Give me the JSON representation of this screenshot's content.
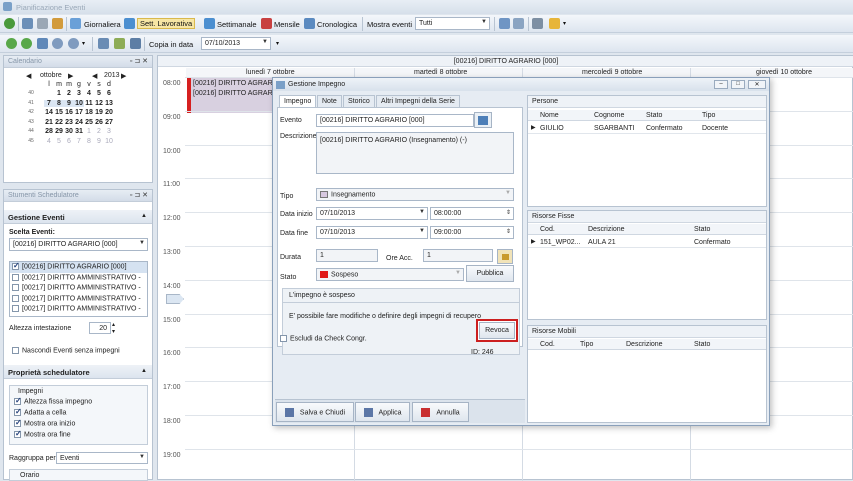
{
  "app": {
    "title": "Pianificazione Eventi"
  },
  "toolbar1": {
    "giornaliera": "Giornaliera",
    "sett_lavorativa": "Sett. Lavorativa",
    "settimanale": "Settimanale",
    "mensile": "Mensile",
    "cronologica": "Cronologica",
    "mostra_eventi_label": "Mostra eventi",
    "mostra_eventi_value": "Tutti"
  },
  "toolbar2": {
    "copia_label": "Copia in data",
    "copia_value": "07/10/2013"
  },
  "calendar": {
    "title": "Calendario",
    "month": "ottobre",
    "year": "2013",
    "weekdays": [
      "l",
      "m",
      "m",
      "g",
      "v",
      "s",
      "d"
    ],
    "weeks": [
      [
        "40",
        "",
        "1",
        "2",
        "3",
        "4",
        "5",
        "6"
      ],
      [
        "41",
        "7",
        "8",
        "9",
        "10",
        "11",
        "12",
        "13"
      ],
      [
        "42",
        "14",
        "15",
        "16",
        "17",
        "18",
        "19",
        "20"
      ],
      [
        "43",
        "21",
        "22",
        "23",
        "24",
        "25",
        "26",
        "27"
      ],
      [
        "44",
        "28",
        "29",
        "30",
        "31",
        "1",
        "2",
        "3"
      ],
      [
        "45",
        "4",
        "5",
        "6",
        "7",
        "8",
        "9",
        "10"
      ]
    ]
  },
  "strumenti": {
    "title": "Stumenti Schedulatore",
    "gestione": "Gestione Eventi",
    "scelta_label": "Scelta Eventi:",
    "scelta_value": "[00216] DIRITTO AGRARIO [000]",
    "events": [
      "[00216] DIRITTO AGRARIO [000]",
      "[00217] DIRITTO AMMINISTRATIVO -",
      "[00217] DIRITTO AMMINISTRATIVO -",
      "[00217] DIRITTO AMMINISTRATIVO -",
      "[00217] DIRITTO AMMINISTRATIVO -"
    ],
    "altezza_label": "Altezza intestazione",
    "altezza_value": "20",
    "nascondi": "Nascondi Eventi senza impegni"
  },
  "proprieta": {
    "title": "Proprietà schedulatore",
    "impegni": "Impegni",
    "opts": [
      "Altezza fissa impegno",
      "Adatta a cella",
      "Mostra ora inizio",
      "Mostra ora fine"
    ],
    "raggruppa_label": "Raggruppa per",
    "raggruppa_value": "Eventi",
    "orario": "Orario"
  },
  "scheduler": {
    "resource": "[00216] DIRITTO AGRARIO [000]",
    "days": [
      "lunedì 7 ottobre",
      "martedì 8 ottobre",
      "mercoledì 9 ottobre",
      "giovedì 10 ottobre"
    ],
    "times": [
      "08:00",
      "09:00",
      "10:00",
      "11:00",
      "12:00",
      "13:00",
      "14:00",
      "15:00",
      "16:00",
      "17:00",
      "18:00",
      "19:00"
    ],
    "appointment": "[00216] DIRITTO AGRARIO"
  },
  "dialog": {
    "title": "Gestione Impegno",
    "tabs": [
      "Impegno",
      "Note",
      "Storico",
      "Altri Impegni della Serie"
    ],
    "evento_label": "Evento",
    "evento_value": "[00216] DIRITTO AGRARIO [000]",
    "descrizione_label": "Descrizione",
    "descrizione_value": "[00216] DIRITTO AGRARIO (Insegnamento) (-)",
    "tipo_label": "Tipo",
    "tipo_value": "Insegnamento",
    "data_inizio_label": "Data inizio",
    "data_inizio": "07/10/2013",
    "ora_inizio": "08:00:00",
    "data_fine_label": "Data fine",
    "data_fine": "07/10/2013",
    "ora_fine": "09:00:00",
    "durata_label": "Durata",
    "durata_value": "1",
    "ore_acc_label": "Ore Acc.",
    "ore_acc_value": "1",
    "stato_label": "Stato",
    "stato_value": "Sospeso",
    "pubblica": "Pubblica",
    "sospeso_title": "L'impegno è sospeso",
    "sospeso_msg": "E' possibile fare modifiche o definire degli impegni di recupero",
    "revoca": "Revoca",
    "escludi": "Escludi da Check Congr.",
    "id": "ID: 246",
    "salva": "Salva e Chiudi",
    "applica": "Applica",
    "annulla": "Annulla",
    "persone": {
      "title": "Persone",
      "cols": [
        "Nome",
        "Cognome",
        "Stato",
        "Tipo"
      ],
      "row": [
        "GIULIO",
        "SGARBANTI",
        "Confermato",
        "Docente"
      ]
    },
    "risorse_fisse": {
      "title": "Risorse Fisse",
      "cols": [
        "Cod.",
        "Descrizione",
        "Stato"
      ],
      "row": [
        "151_WP02...",
        "AULA 21",
        "Confermato"
      ]
    },
    "risorse_mobili": {
      "title": "Risorse Mobili",
      "cols": [
        "Cod.",
        "Tipo",
        "Descrizione",
        "Stato"
      ]
    },
    "colors": {
      "revoca_highlight": "#cc1f1f",
      "stato_swatch": "#e01818",
      "appointment_bar": "#d62020"
    }
  }
}
